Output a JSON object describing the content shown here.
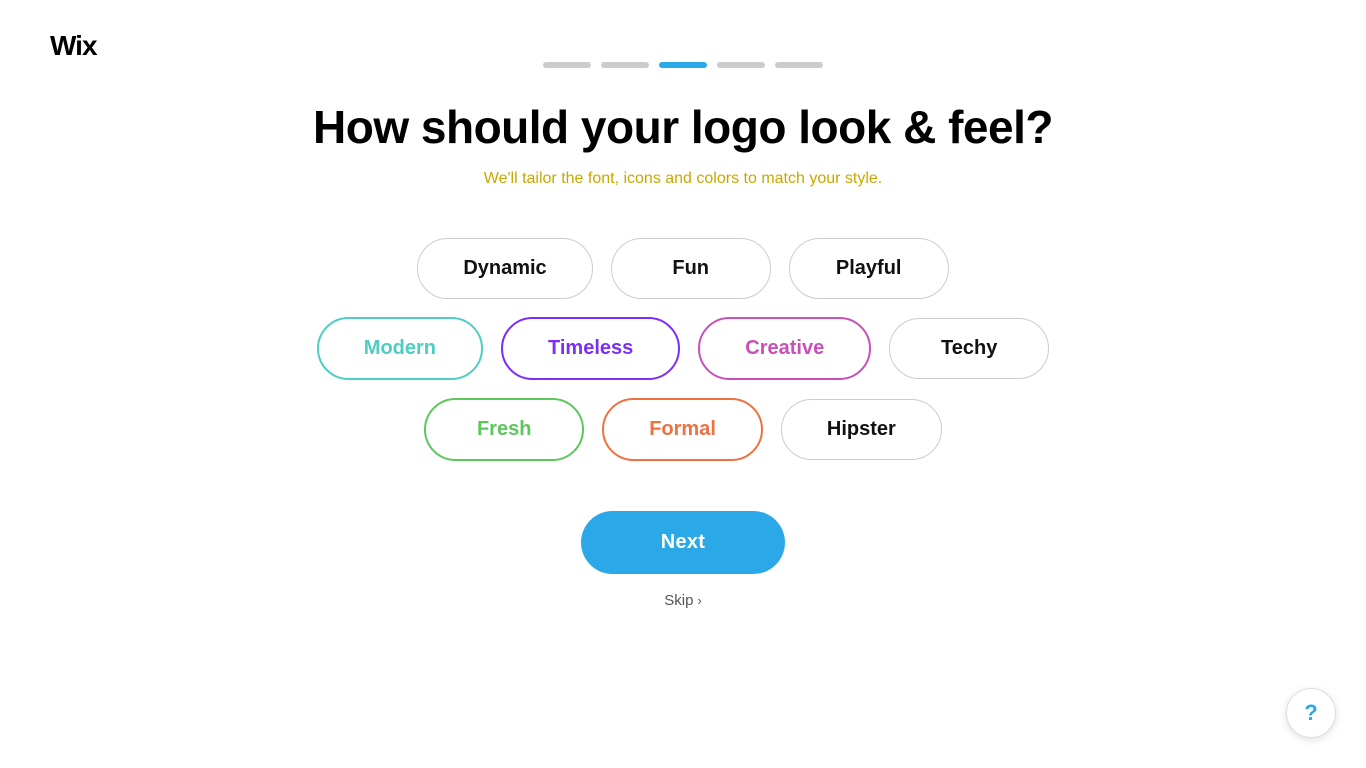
{
  "logo": {
    "text": "Wix"
  },
  "progress": {
    "steps": [
      {
        "color": "#ccc",
        "active": false
      },
      {
        "color": "#ccc",
        "active": false
      },
      {
        "color": "#2ba8e8",
        "active": true
      },
      {
        "color": "#ccc",
        "active": false
      },
      {
        "color": "#ccc",
        "active": false
      }
    ]
  },
  "header": {
    "title": "How should your logo look & feel?",
    "subtitle": "We'll tailor the font, icons and colors to match your style."
  },
  "options": {
    "row1": [
      {
        "label": "Dynamic",
        "style": "default"
      },
      {
        "label": "Fun",
        "style": "default"
      },
      {
        "label": "Playful",
        "style": "default"
      }
    ],
    "row2": [
      {
        "label": "Modern",
        "style": "modern"
      },
      {
        "label": "Timeless",
        "style": "timeless"
      },
      {
        "label": "Creative",
        "style": "creative"
      },
      {
        "label": "Techy",
        "style": "default"
      }
    ],
    "row3": [
      {
        "label": "Fresh",
        "style": "fresh"
      },
      {
        "label": "Formal",
        "style": "formal"
      },
      {
        "label": "Hipster",
        "style": "default"
      }
    ]
  },
  "actions": {
    "next_label": "Next",
    "skip_label": "Skip",
    "help_label": "?"
  }
}
